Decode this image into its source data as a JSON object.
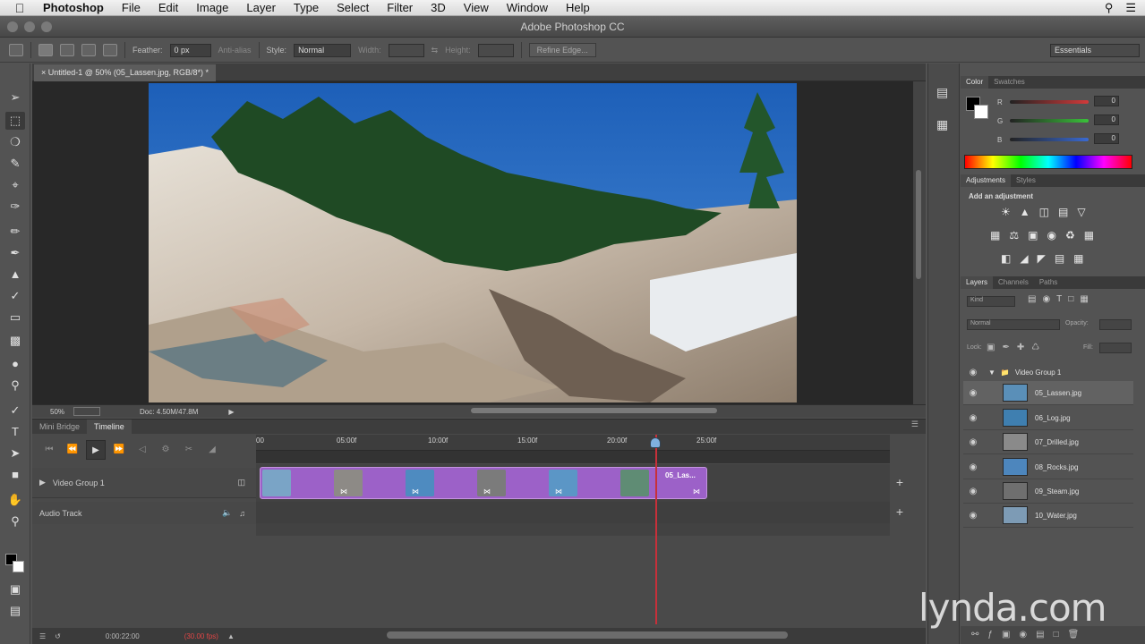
{
  "os_menubar": {
    "app_name": "Photoshop",
    "menus": [
      "File",
      "Edit",
      "Image",
      "Layer",
      "Type",
      "Select",
      "Filter",
      "3D",
      "View",
      "Window",
      "Help"
    ],
    "icons": [
      "apple-icon",
      "spotlight-icon",
      "list-icon"
    ]
  },
  "window": {
    "title": "Adobe Photoshop CC"
  },
  "options_bar": {
    "feather_label": "Feather:",
    "feather_value": "0 px",
    "antialias_label": "Anti-alias",
    "style_label": "Style:",
    "style_value": "Normal",
    "width_label": "Width:",
    "height_label": "Height:",
    "refine_edge": "Refine Edge...",
    "workspace": "Essentials"
  },
  "document": {
    "tab_label": "Untitled-1 @ 50% (05_Lassen.jpg, RGB/8*) *",
    "zoom": "50%",
    "doc_size": "Doc: 4.50M/47.8M"
  },
  "timeline": {
    "tabs": [
      "Mini Bridge",
      "Timeline"
    ],
    "active_tab": "Timeline",
    "ruler_ticks": [
      "00",
      "05:00f",
      "10:00f",
      "15:00f",
      "20:00f",
      "25:00f"
    ],
    "video_track": "Video Group 1",
    "audio_track": "Audio Track",
    "clip_label": "05_Las...",
    "footer_time": "0:00:22:00",
    "footer_fps": "(30.00 fps)",
    "playhead_seconds": 22
  },
  "color_panel": {
    "tabs": [
      "Color",
      "Swatches"
    ],
    "channels": [
      {
        "label": "R",
        "value": "0",
        "color": "#d23a3a"
      },
      {
        "label": "G",
        "value": "0",
        "color": "#3ac23a"
      },
      {
        "label": "B",
        "value": "0",
        "color": "#3a6ad2"
      }
    ]
  },
  "adjustments_panel": {
    "tabs": [
      "Adjustments",
      "Styles"
    ],
    "heading": "Add an adjustment"
  },
  "layers_panel": {
    "tabs": [
      "Layers",
      "Channels",
      "Paths"
    ],
    "kind": "Kind",
    "blend_mode": "Normal",
    "opacity_label": "Opacity:",
    "lock_label": "Lock:",
    "fill_label": "Fill:",
    "group": "Video Group 1",
    "layers": [
      {
        "name": "05_Lassen.jpg",
        "selected": true,
        "color": "#5a8fb8"
      },
      {
        "name": "06_Log.jpg",
        "selected": false,
        "color": "#3f7fb0"
      },
      {
        "name": "07_Drilled.jpg",
        "selected": false,
        "color": "#8a8a8a"
      },
      {
        "name": "08_Rocks.jpg",
        "selected": false,
        "color": "#4d86bd"
      },
      {
        "name": "09_Steam.jpg",
        "selected": false,
        "color": "#6f6f6f"
      },
      {
        "name": "10_Water.jpg",
        "selected": false,
        "color": "#7d9bb5"
      }
    ]
  },
  "watermark": "lynda.com"
}
